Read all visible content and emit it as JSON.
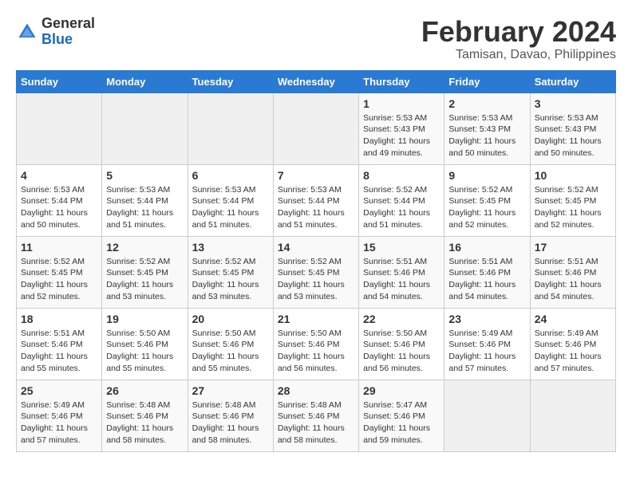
{
  "header": {
    "logo": {
      "line1": "General",
      "line2": "Blue"
    },
    "month_year": "February 2024",
    "location": "Tamisan, Davao, Philippines"
  },
  "days_of_week": [
    "Sunday",
    "Monday",
    "Tuesday",
    "Wednesday",
    "Thursday",
    "Friday",
    "Saturday"
  ],
  "weeks": [
    [
      {
        "day": "",
        "info": ""
      },
      {
        "day": "",
        "info": ""
      },
      {
        "day": "",
        "info": ""
      },
      {
        "day": "",
        "info": ""
      },
      {
        "day": "1",
        "info": "Sunrise: 5:53 AM\nSunset: 5:43 PM\nDaylight: 11 hours and 49 minutes."
      },
      {
        "day": "2",
        "info": "Sunrise: 5:53 AM\nSunset: 5:43 PM\nDaylight: 11 hours and 50 minutes."
      },
      {
        "day": "3",
        "info": "Sunrise: 5:53 AM\nSunset: 5:43 PM\nDaylight: 11 hours and 50 minutes."
      }
    ],
    [
      {
        "day": "4",
        "info": "Sunrise: 5:53 AM\nSunset: 5:44 PM\nDaylight: 11 hours and 50 minutes."
      },
      {
        "day": "5",
        "info": "Sunrise: 5:53 AM\nSunset: 5:44 PM\nDaylight: 11 hours and 51 minutes."
      },
      {
        "day": "6",
        "info": "Sunrise: 5:53 AM\nSunset: 5:44 PM\nDaylight: 11 hours and 51 minutes."
      },
      {
        "day": "7",
        "info": "Sunrise: 5:53 AM\nSunset: 5:44 PM\nDaylight: 11 hours and 51 minutes."
      },
      {
        "day": "8",
        "info": "Sunrise: 5:52 AM\nSunset: 5:44 PM\nDaylight: 11 hours and 51 minutes."
      },
      {
        "day": "9",
        "info": "Sunrise: 5:52 AM\nSunset: 5:45 PM\nDaylight: 11 hours and 52 minutes."
      },
      {
        "day": "10",
        "info": "Sunrise: 5:52 AM\nSunset: 5:45 PM\nDaylight: 11 hours and 52 minutes."
      }
    ],
    [
      {
        "day": "11",
        "info": "Sunrise: 5:52 AM\nSunset: 5:45 PM\nDaylight: 11 hours and 52 minutes."
      },
      {
        "day": "12",
        "info": "Sunrise: 5:52 AM\nSunset: 5:45 PM\nDaylight: 11 hours and 53 minutes."
      },
      {
        "day": "13",
        "info": "Sunrise: 5:52 AM\nSunset: 5:45 PM\nDaylight: 11 hours and 53 minutes."
      },
      {
        "day": "14",
        "info": "Sunrise: 5:52 AM\nSunset: 5:45 PM\nDaylight: 11 hours and 53 minutes."
      },
      {
        "day": "15",
        "info": "Sunrise: 5:51 AM\nSunset: 5:46 PM\nDaylight: 11 hours and 54 minutes."
      },
      {
        "day": "16",
        "info": "Sunrise: 5:51 AM\nSunset: 5:46 PM\nDaylight: 11 hours and 54 minutes."
      },
      {
        "day": "17",
        "info": "Sunrise: 5:51 AM\nSunset: 5:46 PM\nDaylight: 11 hours and 54 minutes."
      }
    ],
    [
      {
        "day": "18",
        "info": "Sunrise: 5:51 AM\nSunset: 5:46 PM\nDaylight: 11 hours and 55 minutes."
      },
      {
        "day": "19",
        "info": "Sunrise: 5:50 AM\nSunset: 5:46 PM\nDaylight: 11 hours and 55 minutes."
      },
      {
        "day": "20",
        "info": "Sunrise: 5:50 AM\nSunset: 5:46 PM\nDaylight: 11 hours and 55 minutes."
      },
      {
        "day": "21",
        "info": "Sunrise: 5:50 AM\nSunset: 5:46 PM\nDaylight: 11 hours and 56 minutes."
      },
      {
        "day": "22",
        "info": "Sunrise: 5:50 AM\nSunset: 5:46 PM\nDaylight: 11 hours and 56 minutes."
      },
      {
        "day": "23",
        "info": "Sunrise: 5:49 AM\nSunset: 5:46 PM\nDaylight: 11 hours and 57 minutes."
      },
      {
        "day": "24",
        "info": "Sunrise: 5:49 AM\nSunset: 5:46 PM\nDaylight: 11 hours and 57 minutes."
      }
    ],
    [
      {
        "day": "25",
        "info": "Sunrise: 5:49 AM\nSunset: 5:46 PM\nDaylight: 11 hours and 57 minutes."
      },
      {
        "day": "26",
        "info": "Sunrise: 5:48 AM\nSunset: 5:46 PM\nDaylight: 11 hours and 58 minutes."
      },
      {
        "day": "27",
        "info": "Sunrise: 5:48 AM\nSunset: 5:46 PM\nDaylight: 11 hours and 58 minutes."
      },
      {
        "day": "28",
        "info": "Sunrise: 5:48 AM\nSunset: 5:46 PM\nDaylight: 11 hours and 58 minutes."
      },
      {
        "day": "29",
        "info": "Sunrise: 5:47 AM\nSunset: 5:46 PM\nDaylight: 11 hours and 59 minutes."
      },
      {
        "day": "",
        "info": ""
      },
      {
        "day": "",
        "info": ""
      }
    ]
  ]
}
